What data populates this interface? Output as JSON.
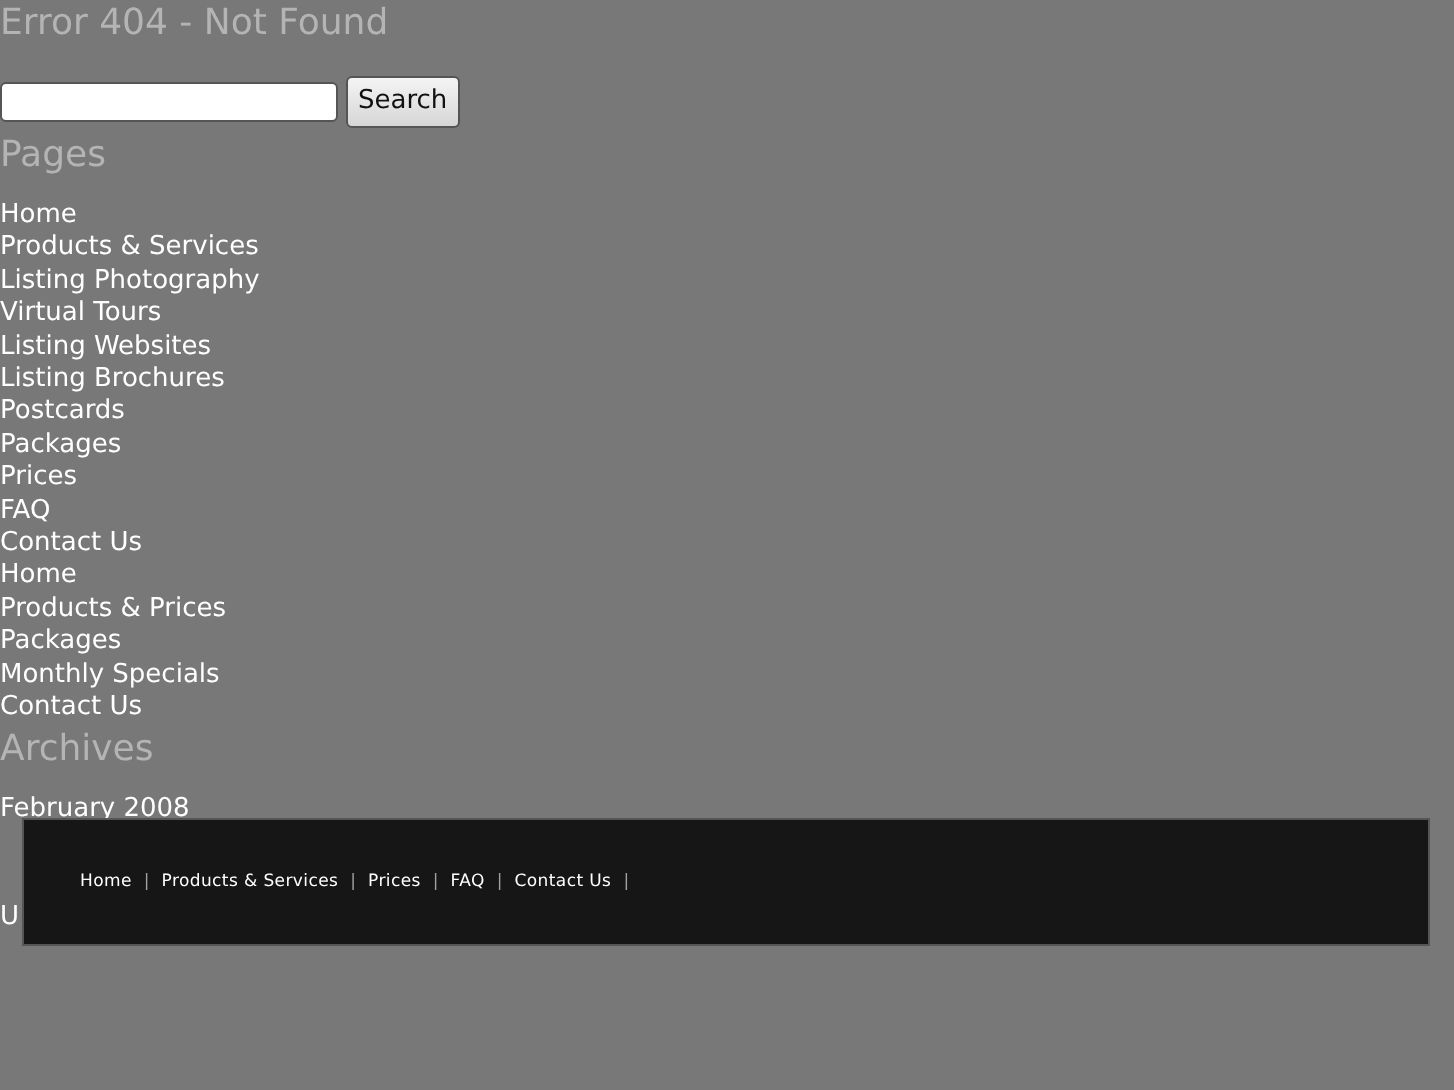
{
  "heading": "Error 404 - Not Found",
  "search": {
    "button": "Search"
  },
  "pages": {
    "title": "Pages",
    "items": [
      "Home",
      "Products & Services",
      "Listing Photography",
      "Virtual Tours",
      "Listing Websites",
      "Listing Brochures",
      "Postcards",
      "Packages",
      "Prices",
      "FAQ",
      "Contact Us",
      "Home",
      "Products & Prices",
      "Packages",
      "Monthly Specials",
      "Contact Us"
    ]
  },
  "archives": {
    "title": "Archives",
    "items": [
      "February 2008"
    ]
  },
  "categories": {
    "items": [
      "U"
    ]
  },
  "footer": {
    "separator": "|",
    "links": [
      "Home",
      "Products & Services",
      "Prices",
      "FAQ",
      "Contact Us"
    ]
  }
}
